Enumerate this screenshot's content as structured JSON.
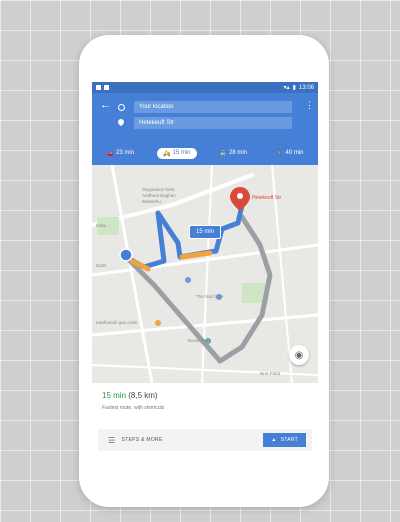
{
  "colors": {
    "header": "#4680d6",
    "statusbar": "#3b6fc0",
    "route_primary": "#4680d6",
    "route_alt": "#9aa0a6",
    "traffic_slow": "#f2a33a",
    "destination": "#d84a3a",
    "eta_green": "#2a9d4b"
  },
  "statusbar": {
    "time": "13:06"
  },
  "header": {
    "back_icon": "arrow-left-icon",
    "origin": "Your location",
    "destination": "Hetekeuft Str",
    "menu_icon": "more-vert-icon"
  },
  "modes": [
    {
      "icon": "car-icon",
      "glyph": "🚗",
      "label": "23 min",
      "active": false
    },
    {
      "icon": "motorbike-icon",
      "glyph": "🛵",
      "label": "15 min",
      "active": true
    },
    {
      "icon": "transit-icon",
      "glyph": "🚆",
      "label": "28 min",
      "active": false
    },
    {
      "icon": "walk-icon",
      "glyph": "🚶",
      "label": "40 min",
      "active": false
    }
  ],
  "map": {
    "eta_chip": "15 min",
    "destination_label": "Hetekeuft Str",
    "labels": [
      "Seyyiresoz Nest",
      "Andhera Baghan",
      "Baltelehu",
      "Kaltu",
      "Dalm",
      "The Nail Cafe",
      "Kanlhandri gas cirde",
      "Bosati Park",
      "Nrot Puba"
    ]
  },
  "summary": {
    "minutes": "15 min",
    "distance": "(8,5 km)",
    "subtitle": "Fastest route, with shortcuts",
    "steps_label": "STEPS & MORE",
    "start_label": "START"
  }
}
